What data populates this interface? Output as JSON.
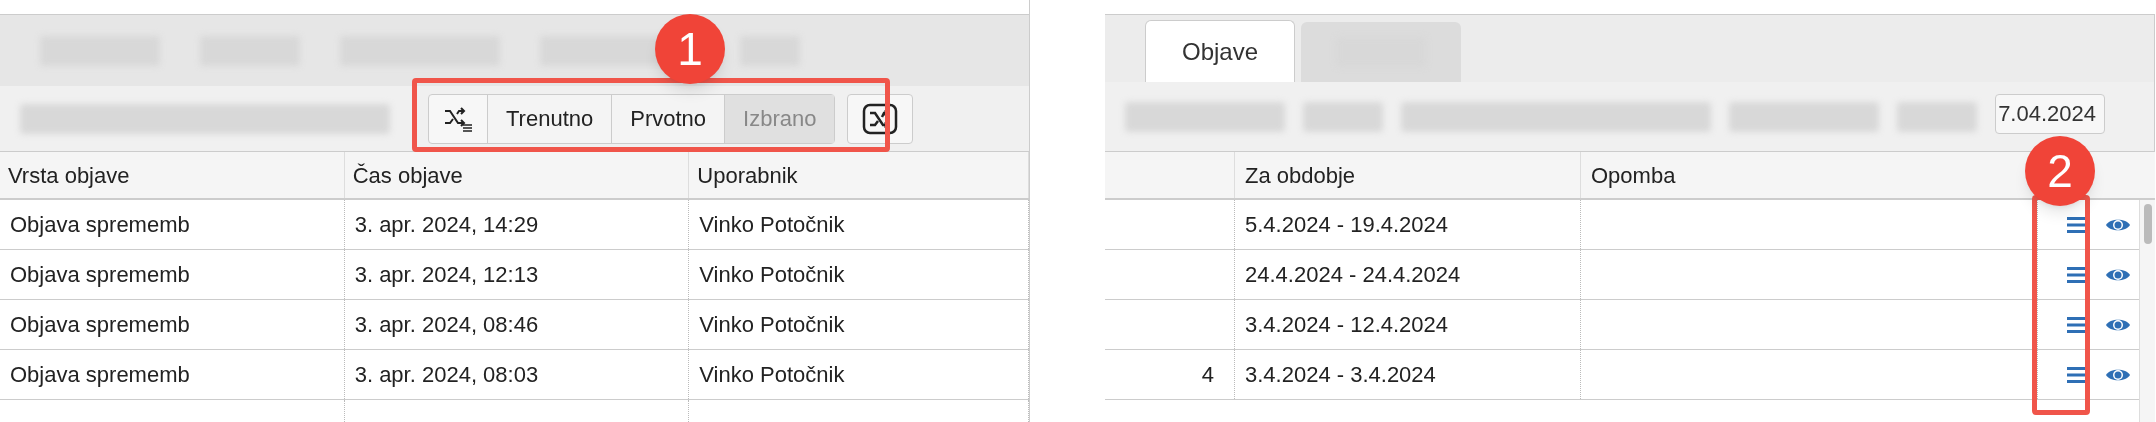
{
  "left_panel": {
    "toolbar": {
      "segments": [
        {
          "label": "Trenutno",
          "selected": false
        },
        {
          "label": "Prvotno",
          "selected": false
        },
        {
          "label": "Izbrano",
          "selected": true
        }
      ]
    },
    "table": {
      "columns": [
        "Vrsta objave",
        "Čas objave",
        "Uporabnik"
      ],
      "rows": [
        [
          "Objava sprememb",
          "3. apr. 2024, 14:29",
          "Vinko Potočnik"
        ],
        [
          "Objava sprememb",
          "3. apr. 2024, 12:13",
          "Vinko Potočnik"
        ],
        [
          "Objava sprememb",
          "3. apr. 2024, 08:46",
          "Vinko Potočnik"
        ],
        [
          "Objava sprememb",
          "3. apr. 2024, 08:03",
          "Vinko Potočnik"
        ]
      ]
    }
  },
  "right_panel": {
    "tabs": [
      {
        "label": "Objave",
        "selected": true
      }
    ],
    "date_to": "7.04.2024",
    "table": {
      "columns": [
        "Za obdobje",
        "Opomba"
      ],
      "rows": [
        {
          "period": "5.4.2024 - 19.4.2024"
        },
        {
          "period": "24.4.2024 - 24.4.2024"
        },
        {
          "period": "3.4.2024 - 12.4.2024"
        },
        {
          "cut_text": "4",
          "period": "3.4.2024 - 3.4.2024"
        }
      ]
    }
  },
  "callouts": [
    {
      "label": "1"
    },
    {
      "label": "2"
    }
  ]
}
